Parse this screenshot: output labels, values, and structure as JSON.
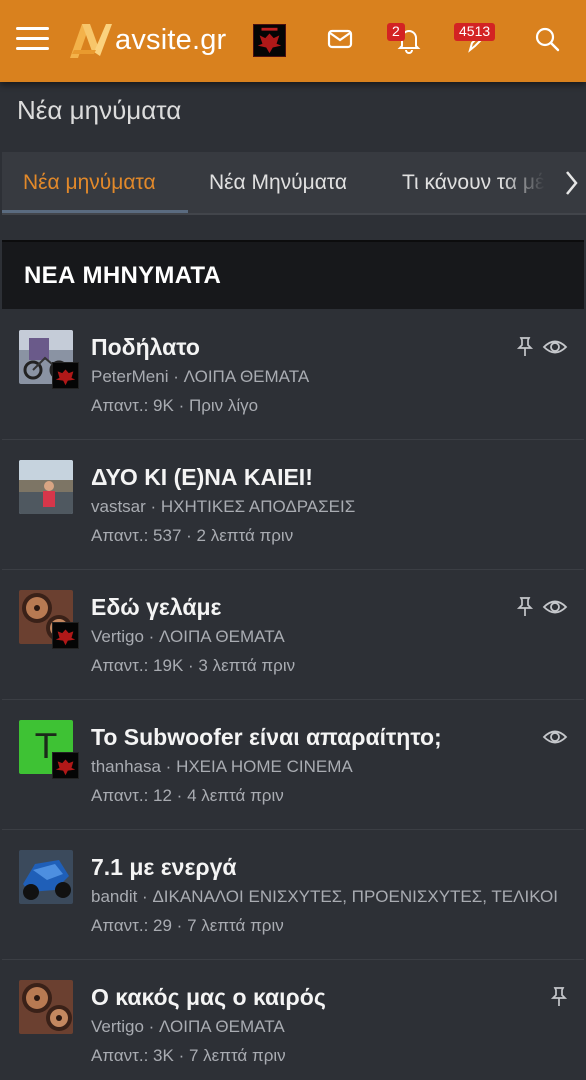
{
  "header": {
    "logo_text": "avsite.gr",
    "alerts_badge": "2",
    "posts_badge": "4513",
    "brand_color": "#d9811e"
  },
  "page_title": "Νέα μηνύματα",
  "tabs": [
    {
      "label": "Νέα μηνύματα",
      "active": true
    },
    {
      "label": "Νέα Μηνύματα",
      "active": false
    },
    {
      "label": "Τι κάνουν τα μέλη",
      "active": false
    }
  ],
  "section_title": "ΝΕΑ ΜΗΝΥΜΑΤΑ",
  "threads": [
    {
      "title": "Ποδήλατο",
      "author": "PeterMeni",
      "forum": "ΛΟΙΠΑ ΘΕΜΑΤΑ",
      "replies": "Απαντ.: 9K",
      "time": "Πριν λίγο",
      "avatar": "photo-bikes",
      "pinned": true,
      "watched": true
    },
    {
      "title": "ΔΥΟ ΚΙ (Ε)ΝΑ ΚΑΙΕΙ!",
      "author": "vastsar",
      "forum": "ΗΧΗΤΙΚΕΣ ΑΠΟΔΡΑΣΕΙΣ",
      "replies": "Απαντ.: 537",
      "time": "2 λεπτά πριν",
      "avatar": "photo-person",
      "pinned": false,
      "watched": false
    },
    {
      "title": "Εδώ γελάμε",
      "author": "Vertigo",
      "forum": "ΛΟΙΠΑ ΘΕΜΑΤΑ",
      "replies": "Απαντ.: 19K",
      "time": "3 λεπτά πριν",
      "avatar": "photo-reels",
      "pinned": true,
      "watched": true
    },
    {
      "title": "Το Subwoofer είναι απαραίτητο;",
      "author": "thanhasa",
      "forum": "ΗΧΕΙΑ HOME CINEMA",
      "replies": "Απαντ.: 12",
      "time": "4 λεπτά πριν",
      "avatar": "letter-T",
      "avatar_letter": "T",
      "pinned": false,
      "watched": true
    },
    {
      "title": "7.1 με ενεργά",
      "author": "bandit",
      "forum": "ΔΙΚΑΝΑΛΟΙ ΕΝΙΣΧΥΤΕΣ, ΠΡΟΕΝΙΣΧΥΤΕΣ, ΤΕΛΙΚΟΙ",
      "replies": "Απαντ.: 29",
      "time": "7 λεπτά πριν",
      "avatar": "photo-motorbike",
      "pinned": false,
      "watched": false
    },
    {
      "title": "Ο κακός μας ο καιρός",
      "author": "Vertigo",
      "forum": "ΛΟΙΠΑ ΘΕΜΑΤΑ",
      "replies": "Απαντ.: 3K",
      "time": "7 λεπτά πριν",
      "avatar": "photo-reels",
      "pinned": true,
      "watched": false
    }
  ]
}
